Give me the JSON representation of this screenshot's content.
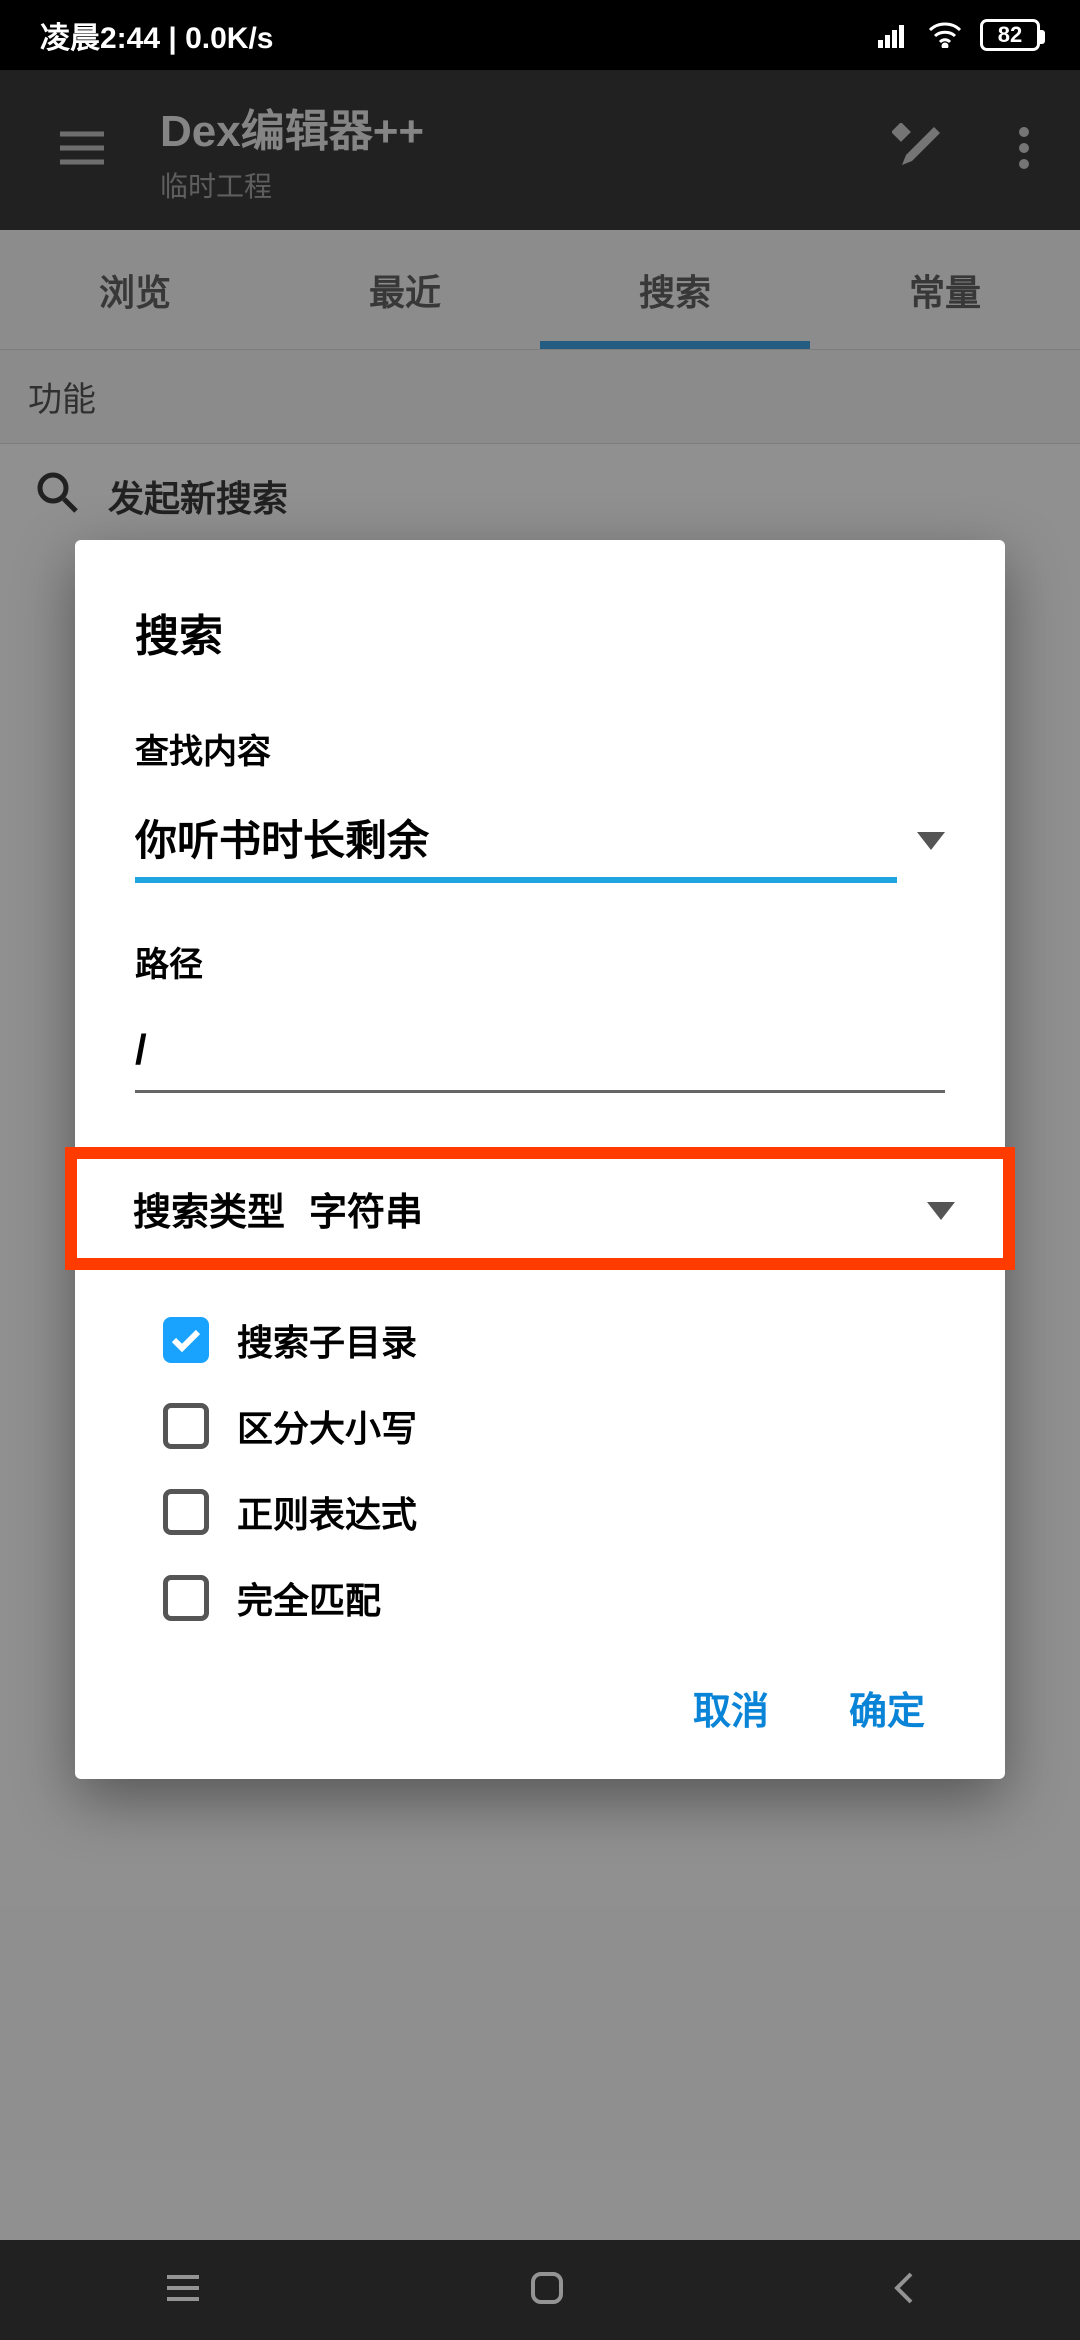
{
  "statusbar": {
    "left": "凌晨2:44 | 0.0K/s",
    "battery": "82"
  },
  "appbar": {
    "title": "Dex编辑器++",
    "subtitle": "临时工程"
  },
  "tabs": {
    "items": [
      "浏览",
      "最近",
      "搜索",
      "常量"
    ],
    "active_index": 2
  },
  "body": {
    "section": "功能",
    "new_search": "发起新搜索"
  },
  "dialog": {
    "title": "搜索",
    "content_label": "查找内容",
    "content_value": "你听书时长剩余",
    "path_label": "路径",
    "path_value": "/",
    "type_label": "搜索类型",
    "type_value": "字符串",
    "options": {
      "subdirs": {
        "label": "搜索子目录",
        "checked": true
      },
      "case": {
        "label": "区分大小写",
        "checked": false
      },
      "regex": {
        "label": "正则表达式",
        "checked": false
      },
      "exact": {
        "label": "完全匹配",
        "checked": false
      }
    },
    "cancel": "取消",
    "ok": "确定"
  }
}
